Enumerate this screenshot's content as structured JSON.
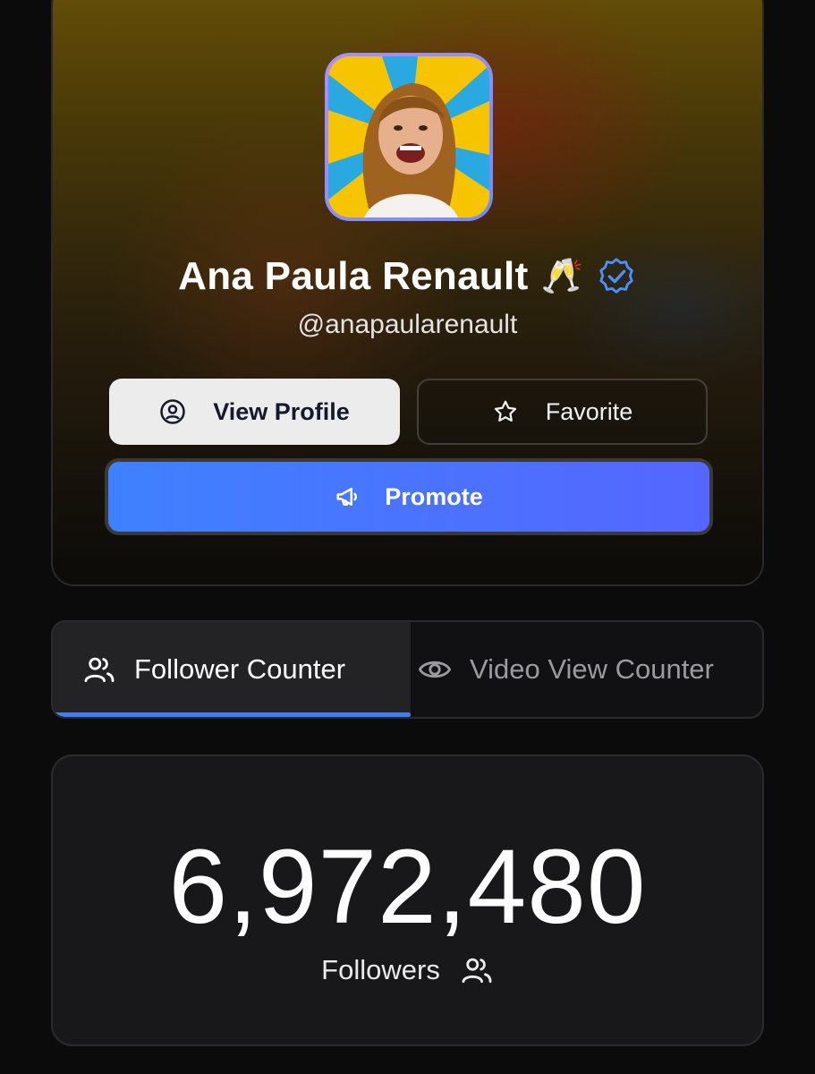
{
  "profile": {
    "name": "Ana Paula Renault",
    "name_emoji": "🥂",
    "handle": "@anapaularenault",
    "verified": true
  },
  "actions": {
    "view_profile_label": "View Profile",
    "favorite_label": "Favorite",
    "promote_label": "Promote"
  },
  "tabs": [
    {
      "label": "Follower Counter",
      "icon": "users-icon",
      "active": true
    },
    {
      "label": "Video View Counter",
      "icon": "eye-icon",
      "active": false
    }
  ],
  "counter": {
    "value": "6,972,480",
    "label": "Followers"
  },
  "colors": {
    "accent": "#3d7dff",
    "promote_start": "#3f81ff",
    "promote_end": "#5566ff",
    "verified": "#4a90ff"
  }
}
